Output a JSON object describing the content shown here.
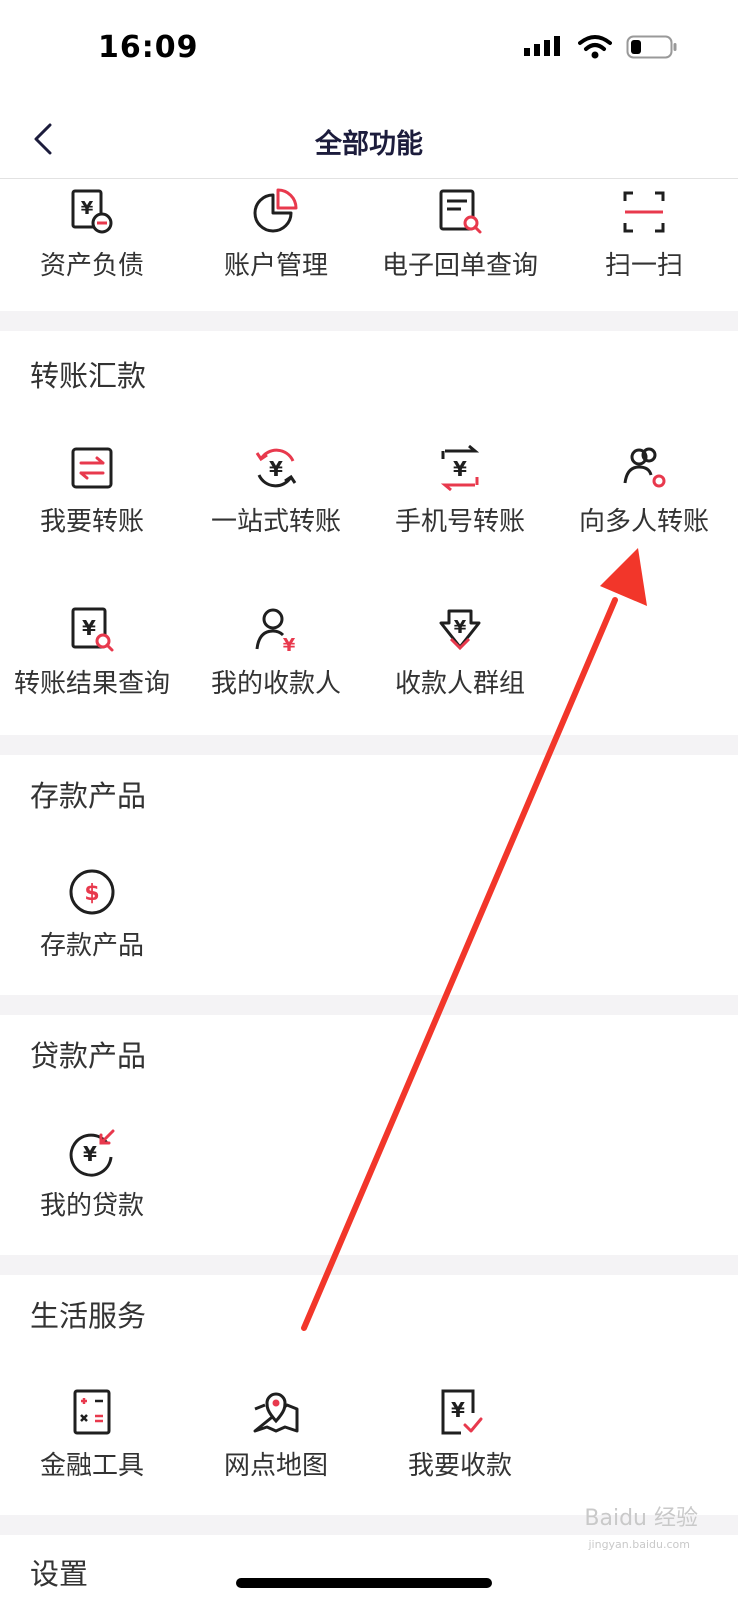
{
  "status_bar": {
    "time": "16:09"
  },
  "nav": {
    "title": "全部功能"
  },
  "top_row": [
    {
      "label": "资产负债",
      "icon": "asset-liability-icon"
    },
    {
      "label": "账户管理",
      "icon": "pie-chart-icon"
    },
    {
      "label": "电子回单查询",
      "icon": "receipt-search-icon"
    },
    {
      "label": "扫一扫",
      "icon": "scan-icon"
    }
  ],
  "sections": {
    "transfer": {
      "title": "转账汇款",
      "items": [
        {
          "label": "我要转账",
          "icon": "transfer-icon"
        },
        {
          "label": "一站式转账",
          "icon": "one-stop-transfer-icon"
        },
        {
          "label": "手机号转账",
          "icon": "phone-transfer-icon"
        },
        {
          "label": "向多人转账",
          "icon": "multi-person-transfer-icon"
        },
        {
          "label": "转账结果查询",
          "icon": "transfer-result-search-icon"
        },
        {
          "label": "我的收款人",
          "icon": "payee-icon"
        },
        {
          "label": "收款人群组",
          "icon": "payee-group-icon"
        }
      ]
    },
    "deposit": {
      "title": "存款产品",
      "items": [
        {
          "label": "存款产品",
          "icon": "dollar-circle-icon"
        }
      ]
    },
    "loan": {
      "title": "贷款产品",
      "items": [
        {
          "label": "我的贷款",
          "icon": "loan-icon"
        }
      ]
    },
    "life": {
      "title": "生活服务",
      "items": [
        {
          "label": "金融工具",
          "icon": "calculator-icon"
        },
        {
          "label": "网点地图",
          "icon": "map-pin-icon"
        },
        {
          "label": "我要收款",
          "icon": "receive-payment-icon"
        }
      ]
    },
    "settings": {
      "title": "设置"
    }
  },
  "watermark": {
    "text": "Baidu 经验",
    "sub": "jingyan.baidu.com"
  },
  "colors": {
    "accent": "#e8394d",
    "icon_dark": "#1f1f1f",
    "section_gap": "#f4f3f5",
    "annotation": "#f2362a"
  }
}
